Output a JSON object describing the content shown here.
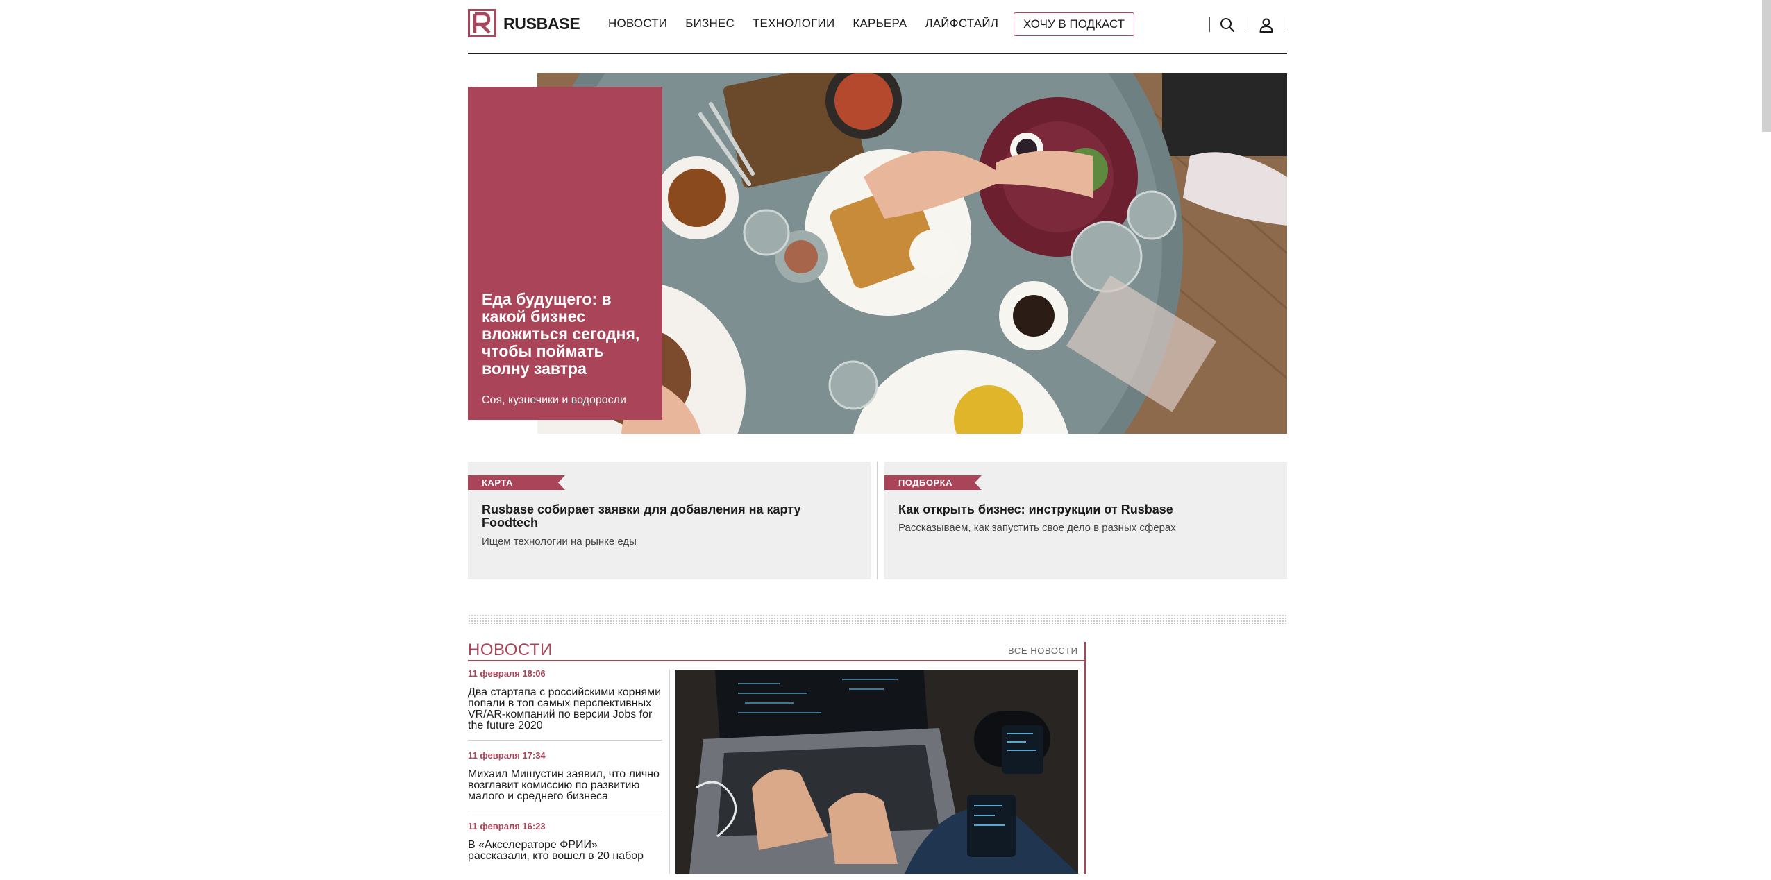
{
  "brand": {
    "name": "RUSBASE",
    "accent": "#aa4559"
  },
  "nav": {
    "items": [
      "НОВОСТИ",
      "БИЗНЕС",
      "ТЕХНОЛОГИИ",
      "КАРЬЕРА",
      "ЛАЙФСТАЙЛ"
    ],
    "podcast_label": "ХОЧУ В ПОДКАСТ"
  },
  "hero": {
    "title": "Еда будущего: в какой бизнес вложиться сегодня, чтобы поймать волну завтра",
    "subtitle": "Соя, кузнечики и водоросли"
  },
  "promos": [
    {
      "tag": "КАРТА",
      "title": "Rusbase собирает заявки для добавления на карту Foodtech",
      "subtitle": "Ищем технологии на рынке еды"
    },
    {
      "tag": "ПОДБОРКА",
      "title": "Как открыть бизнес: инструкции от Rusbase",
      "subtitle": "Рассказываем, как запустить свое дело в разных сферах"
    }
  ],
  "news": {
    "heading": "НОВОСТИ",
    "all_label": "ВСЕ НОВОСТИ",
    "items": [
      {
        "date": "11 февраля 18:06",
        "title": "Два стартапа с российскими корнями попали в топ самых перспективных VR/AR-компаний по версии Jobs for the future 2020"
      },
      {
        "date": "11 февраля 17:34",
        "title": "Михаил Мишустин заявил, что лично возглавит комиссию по развитию малого и среднего бизнеса"
      },
      {
        "date": "11 февраля 16:23",
        "title": "В «Акселераторе ФРИИ» рассказали, кто вошел в 20 набор"
      }
    ]
  }
}
